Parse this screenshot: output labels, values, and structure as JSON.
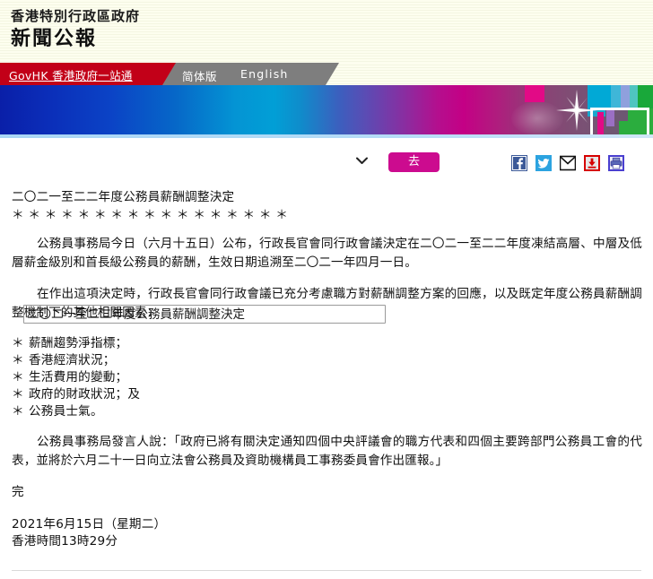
{
  "header": {
    "org_line": "香港特別行政區政府",
    "title_line": "新聞公報"
  },
  "nav": {
    "govhk_label": "GovHK 香港政府一站通",
    "simplified_label": "简体版",
    "english_label": "English",
    "red_color": "#c20018",
    "gray_color": "#7e7e7e"
  },
  "controls": {
    "archive_selected": "二〇二一至二二年度公務員薪酬調整決定",
    "go_label": "去",
    "go_color": "#cc0b8f"
  },
  "share": {
    "facebook": "facebook-icon",
    "twitter": "twitter-icon",
    "email": "email-icon",
    "download": "download-icon",
    "print": "print-icon"
  },
  "article": {
    "title": "二〇二一至二二年度公務員薪酬調整決定",
    "stars": "＊＊＊＊＊＊＊＊＊＊＊＊＊＊＊＊＊",
    "paragraph1": "公務員事務局今日（六月十五日）公布，行政長官會同行政會議決定在二〇二一至二二年度凍結高層、中層及低層薪金級別和首長級公務員的薪酬，生效日期追溯至二〇二一年四月一日。",
    "paragraph2": "在作出這項決定時，行政長官會同行政會議已充分考慮職方對薪酬調整方案的回應，以及既定年度公務員薪酬調整機制下的其他相關因素：",
    "bullets": [
      "薪酬趨勢淨指標；",
      "香港經濟狀況；",
      "生活費用的變動；",
      "政府的財政狀況；及",
      "公務員士氣。"
    ],
    "bullet_symbol": "＊",
    "paragraph3": "公務員事務局發言人說：「政府已將有關決定通知四個中央評議會的職方代表和四個主要跨部門公務員工會的代表，並將於六月二十一日向立法會公務員及資助機構員工事務委員會作出匯報。」",
    "end_mark": "完",
    "date_line": "2021年6月15日（星期二）",
    "time_line": "香港時間13時29分"
  }
}
